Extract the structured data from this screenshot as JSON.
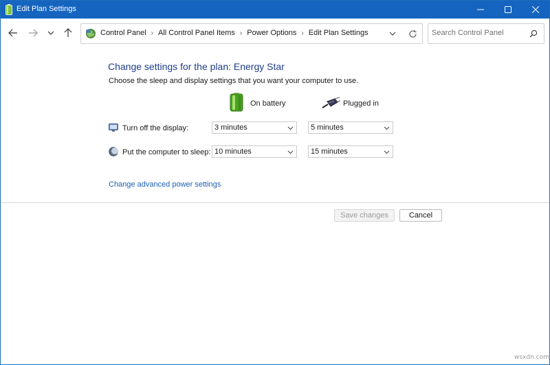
{
  "window": {
    "title": "Edit Plan Settings",
    "controls": {
      "minimize": "minimize",
      "maximize": "maximize",
      "close": "close"
    }
  },
  "nav": {
    "breadcrumbs": [
      "Control Panel",
      "All Control Panel Items",
      "Power Options",
      "Edit Plan Settings"
    ],
    "search": {
      "placeholder": "Search Control Panel",
      "value": ""
    }
  },
  "main": {
    "title": "Change settings for the plan: Energy Star",
    "subtitle": "Choose the sleep and display settings that you want your computer to use.",
    "columns": {
      "battery": "On battery",
      "plugged": "Plugged in"
    },
    "settings": [
      {
        "label": "Turn off the display:",
        "battery": "3 minutes",
        "plugged": "5 minutes"
      },
      {
        "label": "Put the computer to sleep:",
        "battery": "10 minutes",
        "plugged": "15 minutes"
      }
    ],
    "advanced_link": "Change advanced power settings",
    "buttons": {
      "save": "Save changes",
      "cancel": "Cancel"
    }
  },
  "watermark": "wsxdn.com",
  "colors": {
    "titlebar": "#1565c0",
    "heading": "#1e3e8c",
    "link": "#1a5fb4"
  }
}
